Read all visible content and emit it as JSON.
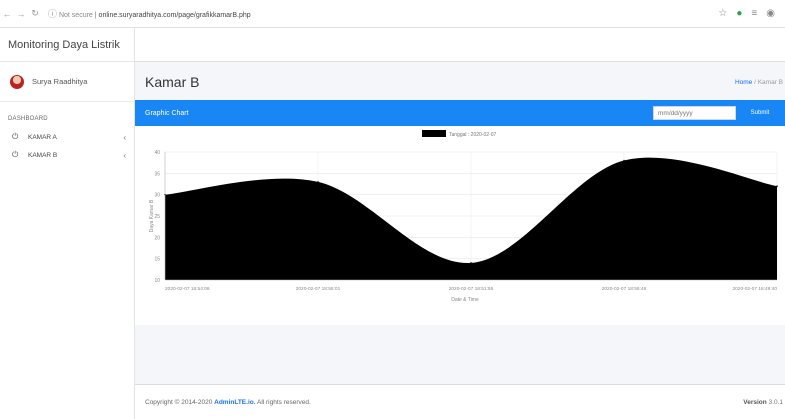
{
  "browser": {
    "security": "Not secure",
    "url": "online.suryaradhitya.com/page/grafikkamarB.php"
  },
  "sidebar": {
    "brand": "Monitoring Daya Listrik",
    "user_name": "Surya Raadhitya",
    "section_label": "DASHBOARD",
    "items": [
      {
        "label": "KAMAR A",
        "icon": "plug-icon"
      },
      {
        "label": "KAMAR B",
        "icon": "plug-icon"
      }
    ]
  },
  "page": {
    "title": "Kamar B",
    "breadcrumb_home": "Home",
    "breadcrumb_sep": " / ",
    "breadcrumb_current": "Kamar B"
  },
  "card": {
    "title": "Graphic Chart",
    "date_placeholder": "mm/dd/yyyy",
    "submit_label": "Submit"
  },
  "chart_data": {
    "type": "area",
    "legend_label": "Tanggal : 2020-02-07",
    "legend_position": "top-center",
    "ylabel": "Daya Kamar B",
    "xlabel": "Date & Time",
    "ylim": [
      10,
      40
    ],
    "yticks": [
      10,
      15,
      20,
      25,
      30,
      35,
      40
    ],
    "x": [
      "2020-02-07 18:54:06",
      "2020-02-07 18:55:01",
      "2020-02-07 18:51:55",
      "2020-02-07 18:55:46",
      "2020-02-07 18:49:40"
    ],
    "values": [
      30,
      33,
      14,
      38,
      32
    ],
    "fill_color": "#000000",
    "grid": true
  },
  "footer": {
    "copyright_prefix": "Copyright © 2014-2020 ",
    "brand": "AdminLTE.io.",
    "copyright_suffix": " All rights reserved.",
    "version_label": "Version",
    "version_value": "3.0.1"
  }
}
